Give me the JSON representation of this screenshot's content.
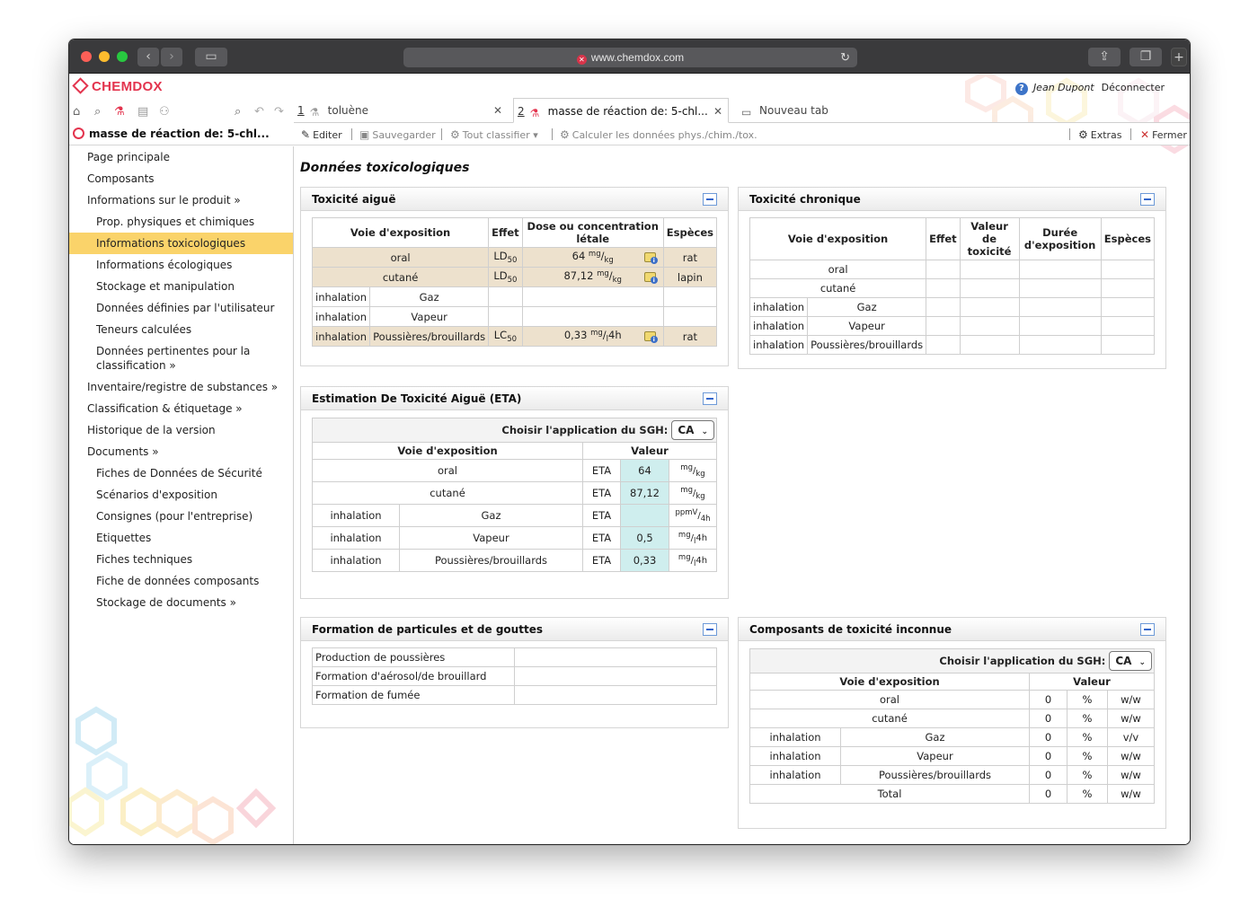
{
  "browser": {
    "url": "www.chemdox.com"
  },
  "app": {
    "brand": "CHEMDOX",
    "user_name": "Jean Dupont",
    "logout": "Déconnecter",
    "help": "?",
    "tabs": [
      {
        "num": "1",
        "label": "toluène"
      },
      {
        "num": "2",
        "label": "masse de réaction de: 5-chl..."
      },
      {
        "label": "Nouveau tab"
      }
    ],
    "breadcrumb": "masse de réaction de: 5-chl...",
    "toolbar": {
      "edit": "Editer",
      "save": "Sauvegarder",
      "classify": "Tout classifier",
      "calc": "Calculer les données phys./chim./tox.",
      "extras": "Extras",
      "close": "Fermer"
    }
  },
  "sidebar": {
    "items": [
      {
        "label": "Page principale",
        "level": 0
      },
      {
        "label": "Composants",
        "level": 0
      },
      {
        "label": "Informations sur le produit »",
        "level": 0
      },
      {
        "label": "Prop. physiques et chimiques",
        "level": 1
      },
      {
        "label": "Informations toxicologiques",
        "level": 1,
        "active": true
      },
      {
        "label": "Informations écologiques",
        "level": 1
      },
      {
        "label": "Stockage et manipulation",
        "level": 1
      },
      {
        "label": "Données définies par l'utilisateur",
        "level": 1
      },
      {
        "label": "Teneurs calculées",
        "level": 1
      },
      {
        "label": "Données pertinentes pour la classification »",
        "level": 1
      },
      {
        "label": "Inventaire/registre de substances »",
        "level": 0
      },
      {
        "label": "Classification & étiquetage »",
        "level": 0
      },
      {
        "label": "Historique de la version",
        "level": 0
      },
      {
        "label": "Documents »",
        "level": 0
      },
      {
        "label": "Fiches de Données de Sécurité",
        "level": 1
      },
      {
        "label": "Scénarios d'exposition",
        "level": 1
      },
      {
        "label": "Consignes (pour l'entreprise)",
        "level": 1
      },
      {
        "label": "Etiquettes",
        "level": 1
      },
      {
        "label": "Fiches techniques",
        "level": 1
      },
      {
        "label": "Fiche de données composants",
        "level": 1
      },
      {
        "label": "Stockage de documents »",
        "level": 1
      }
    ]
  },
  "main": {
    "title": "Données toxicologiques",
    "acute": {
      "title": "Toxicité aiguë",
      "headers": [
        "Voie d'exposition",
        "Effet",
        "Dose ou concentration létale",
        "Espèces"
      ],
      "rows": [
        {
          "route": "oral",
          "effect": "LD",
          "effect_sub": "50",
          "dose": "64",
          "unit_a": "mg",
          "unit_b": "kg",
          "unit_c": "",
          "species": "rat",
          "hl": true
        },
        {
          "route": "cutané",
          "effect": "LD",
          "effect_sub": "50",
          "dose": "87,12",
          "unit_a": "mg",
          "unit_b": "kg",
          "unit_c": "",
          "species": "lapin",
          "hl": true
        },
        {
          "route": "inhalation",
          "form": "Gaz",
          "effect": "",
          "dose": "",
          "species": ""
        },
        {
          "route": "inhalation",
          "form": "Vapeur",
          "effect": "",
          "dose": "",
          "species": ""
        },
        {
          "route": "inhalation",
          "form": "Poussières/brouillards",
          "effect": "LC",
          "effect_sub": "50",
          "dose": "0,33",
          "unit_a": "mg",
          "unit_b": "l",
          "unit_c": "4h",
          "species": "rat",
          "hl": true
        }
      ]
    },
    "chronic": {
      "title": "Toxicité chronique",
      "headers": [
        "Voie d'exposition",
        "Effet",
        "Valeur de toxicité",
        "Durée d'exposition",
        "Espèces"
      ],
      "rows": [
        {
          "route": "oral"
        },
        {
          "route": "cutané"
        },
        {
          "route": "inhalation",
          "form": "Gaz"
        },
        {
          "route": "inhalation",
          "form": "Vapeur"
        },
        {
          "route": "inhalation",
          "form": "Poussières/brouillards"
        }
      ]
    },
    "eta": {
      "title": "Estimation De Toxicité Aiguë (ETA)",
      "sgh_label": "Choisir l'application du SGH:",
      "sgh_value": "CA",
      "headers": [
        "Voie d'exposition",
        "Valeur"
      ],
      "rows": [
        {
          "route": "oral",
          "label": "ETA",
          "value": "64",
          "unit_a": "mg",
          "unit_b": "kg",
          "unit_c": ""
        },
        {
          "route": "cutané",
          "label": "ETA",
          "value": "87,12",
          "unit_a": "mg",
          "unit_b": "kg",
          "unit_c": ""
        },
        {
          "route": "inhalation",
          "form": "Gaz",
          "label": "ETA",
          "value": "",
          "unit_a": "ppmV",
          "unit_b": "4h",
          "unit_c": ""
        },
        {
          "route": "inhalation",
          "form": "Vapeur",
          "label": "ETA",
          "value": "0,5",
          "unit_a": "mg",
          "unit_b": "l",
          "unit_c": "4h"
        },
        {
          "route": "inhalation",
          "form": "Poussières/brouillards",
          "label": "ETA",
          "value": "0,33",
          "unit_a": "mg",
          "unit_b": "l",
          "unit_c": "4h"
        }
      ]
    },
    "particles": {
      "title": "Formation de particules et de gouttes",
      "rows": [
        "Production de poussières",
        "Formation d'aérosol/de brouillard",
        "Formation de fumée"
      ]
    },
    "unknown": {
      "title": "Composants de toxicité inconnue",
      "sgh_label": "Choisir l'application du SGH:",
      "sgh_value": "CA",
      "headers": [
        "Voie d'exposition",
        "Valeur"
      ],
      "rows": [
        {
          "route": "oral",
          "value": "0",
          "pct": "%",
          "unit": "w/w"
        },
        {
          "route": "cutané",
          "value": "0",
          "pct": "%",
          "unit": "w/w"
        },
        {
          "route": "inhalation",
          "form": "Gaz",
          "value": "0",
          "pct": "%",
          "unit": "v/v"
        },
        {
          "route": "inhalation",
          "form": "Vapeur",
          "value": "0",
          "pct": "%",
          "unit": "w/w"
        },
        {
          "route": "inhalation",
          "form": "Poussières/brouillards",
          "value": "0",
          "pct": "%",
          "unit": "w/w"
        },
        {
          "route": "Total",
          "value": "0",
          "pct": "%",
          "unit": "w/w"
        }
      ]
    }
  }
}
